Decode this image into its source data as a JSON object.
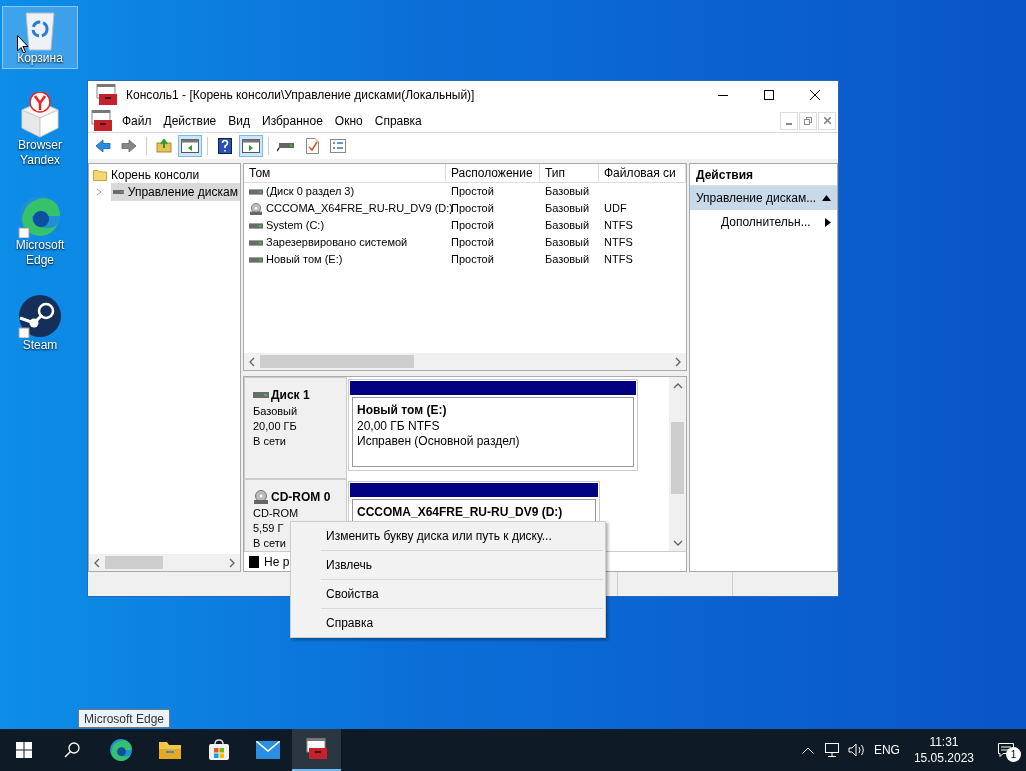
{
  "desktop_icons": [
    {
      "kind": "bin",
      "label": "Корзина",
      "selected": true
    },
    {
      "kind": "yandex",
      "label": "Browser Yandex",
      "selected": false
    },
    {
      "kind": "edge",
      "label": "Microsoft Edge",
      "selected": false
    },
    {
      "kind": "steam",
      "label": "Steam",
      "selected": false
    }
  ],
  "window": {
    "title": "Консоль1 - [Корень консоли\\Управление дисками(Локальный)]",
    "menu": [
      "Файл",
      "Действие",
      "Вид",
      "Избранное",
      "Окно",
      "Справка"
    ],
    "toolbar": [
      {
        "kind": "back",
        "pressed": false
      },
      {
        "kind": "forward",
        "pressed": false
      },
      {
        "kind": "sep"
      },
      {
        "kind": "up",
        "pressed": false
      },
      {
        "kind": "tree",
        "pressed": true
      },
      {
        "kind": "sep"
      },
      {
        "kind": "help",
        "pressed": false
      },
      {
        "kind": "actions",
        "pressed": true
      },
      {
        "kind": "sep"
      },
      {
        "kind": "drive",
        "pressed": false
      },
      {
        "kind": "check",
        "pressed": false
      },
      {
        "kind": "list",
        "pressed": false
      }
    ],
    "tree": [
      {
        "label": "Корень консоли",
        "children": [
          {
            "label": "Управление дискам",
            "selected": true,
            "expanded": false
          }
        ]
      }
    ],
    "volumes": {
      "columns": [
        "Том",
        "Расположение",
        "Тип",
        "Файловая си"
      ],
      "rows": [
        {
          "kind": "disk",
          "cells": [
            "(Диск 0 раздел 3)",
            "Простой",
            "Базовый",
            ""
          ]
        },
        {
          "kind": "cdrom",
          "cells": [
            "CCCOMA_X64FRE_RU-RU_DV9 (D:)",
            "Простой",
            "Базовый",
            "UDF"
          ]
        },
        {
          "kind": "disk",
          "cells": [
            "System (C:)",
            "Простой",
            "Базовый",
            "NTFS"
          ]
        },
        {
          "kind": "disk",
          "cells": [
            "Зарезервировано системой",
            "Простой",
            "Базовый",
            "NTFS"
          ]
        },
        {
          "kind": "disk",
          "cells": [
            "Новый том (E:)",
            "Простой",
            "Базовый",
            "NTFS"
          ]
        }
      ]
    },
    "disks": [
      {
        "kind": "disk",
        "name": "Диск 1",
        "lines": [
          "Базовый",
          "20,00 ГБ",
          "В сети"
        ],
        "partition": {
          "name": "Новый том  (E:)",
          "lines": [
            "20,00 ГБ NTFS",
            "Исправен (Основной раздел)"
          ]
        }
      },
      {
        "kind": "cdrom",
        "name": "CD-ROM 0",
        "lines": [
          "CD-ROM",
          "5,59 Г",
          "В сети"
        ],
        "partition": {
          "name": "CCCOMA_X64FRE_RU-RU_DV9  (D:)"
        }
      }
    ],
    "legend": [
      {
        "label": "Не р",
        "color": "#000000"
      }
    ],
    "actions": {
      "title": "Действия",
      "items": [
        {
          "kind": "section",
          "label": "Управление дискам...",
          "selected": true
        },
        {
          "kind": "submenu",
          "label": "Дополнительн...",
          "selected": false
        }
      ]
    }
  },
  "context_menu": [
    "Изменить букву диска или путь к диску...",
    "Извлечь",
    "Свойства",
    "Справка"
  ],
  "taskbar": {
    "tooltip": "Microsoft Edge",
    "apps": [
      {
        "kind": "edge",
        "active": false
      },
      {
        "kind": "explorer",
        "active": false
      },
      {
        "kind": "store",
        "active": false
      },
      {
        "kind": "mail",
        "active": false
      },
      {
        "kind": "console",
        "active": true
      }
    ],
    "language": "ENG",
    "time": "11:31",
    "date": "15.05.2023",
    "notifications": "1"
  }
}
